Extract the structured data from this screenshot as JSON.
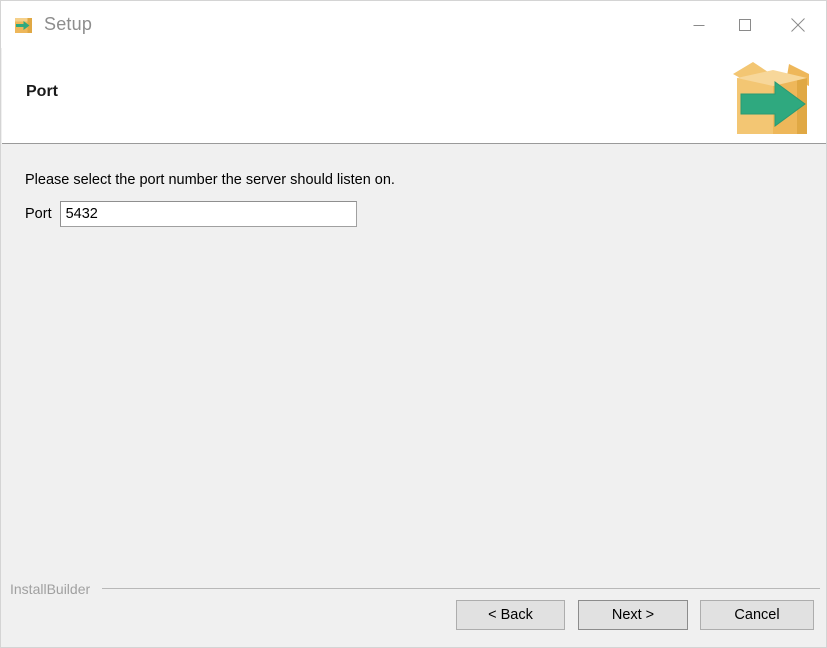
{
  "window": {
    "title": "Setup",
    "icon": "package-arrow-icon",
    "controls": [
      {
        "name": "minimize",
        "glyph": "minimize-icon"
      },
      {
        "name": "maximize",
        "glyph": "maximize-icon"
      },
      {
        "name": "close",
        "glyph": "close-icon"
      }
    ]
  },
  "header": {
    "title": "Port",
    "logo": "installbuilder-box-arrow-logo"
  },
  "content": {
    "instruction": "Please select the port number the server should listen on.",
    "field": {
      "label": "Port",
      "value": "5432",
      "placeholder": ""
    }
  },
  "footer": {
    "brand": "InstallBuilder",
    "buttons": {
      "back": "< Back",
      "next": "Next >",
      "cancel": "Cancel"
    }
  },
  "colors": {
    "box_light": "#f3c673",
    "box_mid": "#eeb75a",
    "box_dark": "#e0a844",
    "arrow_green": "#2fa97f",
    "content_bg": "#f0f0f0",
    "header_bg": "#ffffff",
    "title_text": "#8d8d8d"
  }
}
